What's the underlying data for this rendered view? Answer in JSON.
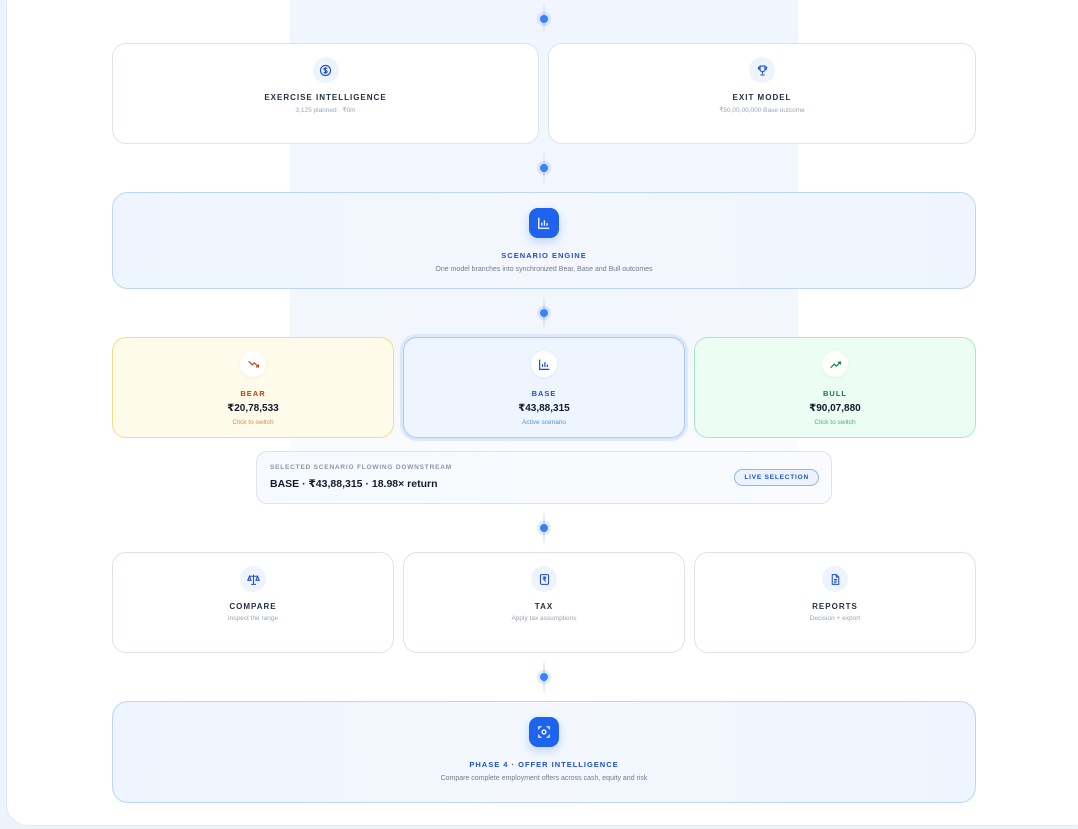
{
  "exercise": {
    "title": "EXERCISE INTELLIGENCE",
    "subtitle": "3,125 planned · ₹0m",
    "icon": "dollar-coin-icon"
  },
  "exit_model": {
    "title": "EXIT MODEL",
    "subtitle": "₹50,00,00,000 Base outcome",
    "icon": "trophy-icon"
  },
  "scenario_engine": {
    "title": "SCENARIO ENGINE",
    "subtitle": "One model branches into synchronized Bear, Base and Bull outcomes",
    "icon": "bar-chart-icon"
  },
  "scenarios": [
    {
      "label": "BEAR",
      "value": "₹20,78,533",
      "caption": "Click to switch",
      "icon": "trend-down-icon",
      "accent": "#c2410c"
    },
    {
      "label": "BASE",
      "value": "₹43,88,315",
      "caption": "Active scenario",
      "icon": "bar-chart-icon",
      "accent": "#1d4fd6"
    },
    {
      "label": "BULL",
      "value": "₹90,07,880",
      "caption": "Click to switch",
      "icon": "trend-up-icon",
      "accent": "#15803d"
    }
  ],
  "selection": {
    "label": "SELECTED SCENARIO FLOWING DOWNSTREAM",
    "value": "BASE · ₹43,88,315 · 18.98× return",
    "badge": "LIVE SELECTION"
  },
  "tools": [
    {
      "title": "COMPARE",
      "subtitle": "Inspect the range",
      "icon": "scale-icon"
    },
    {
      "title": "TAX",
      "subtitle": "Apply tax assumptions",
      "icon": "rupee-receipt-icon"
    },
    {
      "title": "REPORTS",
      "subtitle": "Decision + export",
      "icon": "document-icon"
    }
  ],
  "phase4": {
    "title": "PHASE 4 · OFFER INTELLIGENCE",
    "subtitle": "Compare complete employment offers across cash, equity and risk",
    "icon": "scan-icon"
  },
  "colors": {
    "accent": "#1d63ed",
    "bear_bg": "#fffbea",
    "base_bg": "#eef5fe",
    "bull_bg": "#ecfdf3"
  }
}
